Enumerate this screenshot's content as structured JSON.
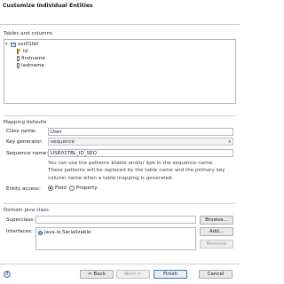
{
  "dialog": {
    "title": "Customize Individual Entities"
  },
  "tables_section": {
    "label": "Tables and columns",
    "tree": {
      "table": "usr01tbl",
      "columns": [
        "id",
        "firstname",
        "lastname"
      ]
    }
  },
  "mapping": {
    "label": "Mapping defaults",
    "class_name_label": "Class name:",
    "class_name_value": "User",
    "key_generator_label": "Key generator:",
    "key_generator_value": "sequence",
    "sequence_name_label": "Sequence name:",
    "sequence_name_value": "USR01TBL_ID_SEQ",
    "info_line1": "You can use the patterns $table and/or $pk in the sequence name.",
    "info_line2": "These patterns will be replaced by the table name and the primary key",
    "info_line3": "column name when a table mapping is generated.",
    "entity_access_label": "Entity access:",
    "access_field": "Field",
    "access_property": "Property",
    "access_selected": "Field"
  },
  "domain": {
    "label": "Domain java class",
    "superclass_label": "Superclass:",
    "superclass_value": "",
    "browse_button": "Browse...",
    "interfaces_label": "Interfaces:",
    "interfaces": [
      "java.io.Serializable"
    ],
    "add_button": "Add...",
    "remove_button": "Remove"
  },
  "footer": {
    "help": "?",
    "back": "< Back",
    "next": "Next >",
    "finish": "Finish",
    "cancel": "Cancel"
  }
}
